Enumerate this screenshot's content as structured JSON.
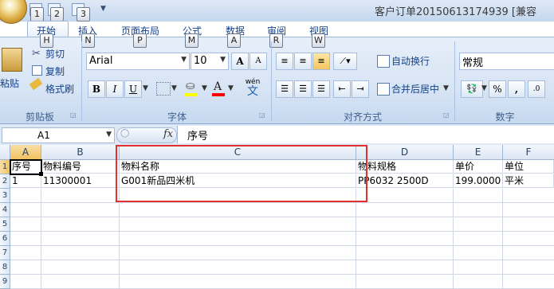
{
  "window": {
    "title": "客户订单20150613174939 [兼容"
  },
  "quick_access": {
    "keytips": [
      "1",
      "2",
      "3"
    ]
  },
  "tabs": [
    {
      "label": "开始",
      "keytip": "H"
    },
    {
      "label": "插入",
      "keytip": "N"
    },
    {
      "label": "页面布局",
      "keytip": "P"
    },
    {
      "label": "公式",
      "keytip": "M"
    },
    {
      "label": "数据",
      "keytip": "A"
    },
    {
      "label": "审阅",
      "keytip": "R"
    },
    {
      "label": "视图",
      "keytip": "W"
    }
  ],
  "clipboard": {
    "paste": "粘贴",
    "cut": "剪切",
    "copy": "复制",
    "format_painter": "格式刷",
    "group_label": "剪贴板"
  },
  "font": {
    "font_name": "Arial",
    "font_size": "10",
    "grow": "A",
    "shrink": "A",
    "bold": "B",
    "italic": "I",
    "underline": "U",
    "font_color_letter": "A",
    "phonetic": "wén",
    "phonetic_char": "文",
    "group_label": "字体",
    "highlight_color": "#ffff00",
    "font_color": "#ff0000"
  },
  "alignment": {
    "wrap_text": "自动换行",
    "merge_center": "合并后居中",
    "group_label": "对齐方式"
  },
  "number": {
    "format": "常规",
    "percent": "%",
    "comma": ",",
    "group_label": "数字"
  },
  "formula_bar": {
    "name_box": "A1",
    "fx": "fx",
    "content": "序号"
  },
  "sheet": {
    "columns": [
      "A",
      "B",
      "C",
      "D",
      "E",
      "F"
    ],
    "rows": [
      "1",
      "2",
      "3",
      "4",
      "5",
      "6",
      "7",
      "8",
      "9"
    ],
    "data": [
      [
        "序号",
        "物料编号",
        "物料名称",
        "物料规格",
        "单价",
        "单位"
      ],
      [
        "1",
        "11300001",
        "G001新品四米机",
        "PP6032 2500D",
        "199.0000",
        "平米"
      ]
    ]
  }
}
